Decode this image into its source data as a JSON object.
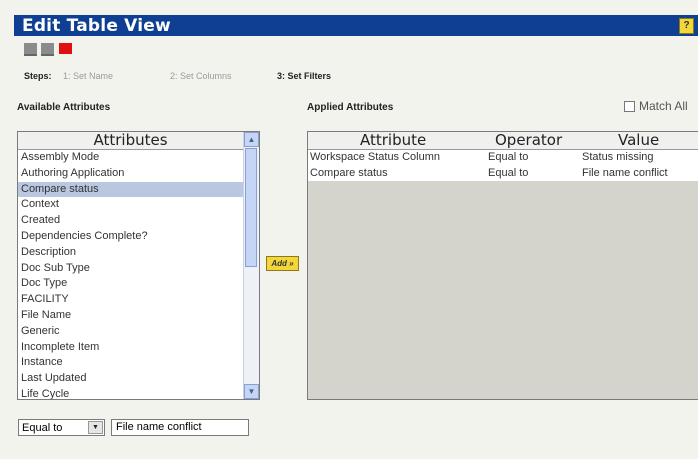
{
  "header": {
    "title": "Edit Table View",
    "help_label": "?"
  },
  "steps": {
    "label": "Steps:",
    "items": [
      "1: Set Name",
      "2: Set Columns",
      "3: Set Filters"
    ],
    "current_index": 2
  },
  "available": {
    "heading": "Available Attributes",
    "column_header": "Attributes",
    "items": [
      "Assembly Mode",
      "Authoring Application",
      "Compare status",
      "Context",
      "Created",
      "Dependencies Complete?",
      "Description",
      "Doc Sub Type",
      "Doc Type",
      "FACILITY",
      "File Name",
      "Generic",
      "Incomplete Item",
      "Instance",
      "Last Updated",
      "Life Cycle"
    ],
    "selected_item": "Compare status"
  },
  "add_button": {
    "label": "Add »"
  },
  "applied": {
    "heading": "Applied Attributes",
    "match_all_label": "Match All",
    "match_all_checked": false,
    "columns": {
      "attribute": "Attribute",
      "operator": "Operator",
      "value": "Value"
    },
    "rows": [
      {
        "attribute": "Workspace Status Column",
        "operator": "Equal to",
        "value": "Status missing"
      },
      {
        "attribute": "Compare status",
        "operator": "Equal to",
        "value": "File name conflict"
      }
    ]
  },
  "filter_editor": {
    "operator": "Equal to",
    "value": "File name conflict"
  },
  "colors": {
    "title_bar": "#0f3f92",
    "current_step": "#e01010",
    "selection": "#b9c7e0",
    "button": "#f2d63a"
  },
  "icons": {
    "help": "help-icon",
    "scroll_up": "scroll-up-arrow-icon",
    "scroll_down": "scroll-down-arrow-icon",
    "dropdown": "chevron-down-icon"
  }
}
